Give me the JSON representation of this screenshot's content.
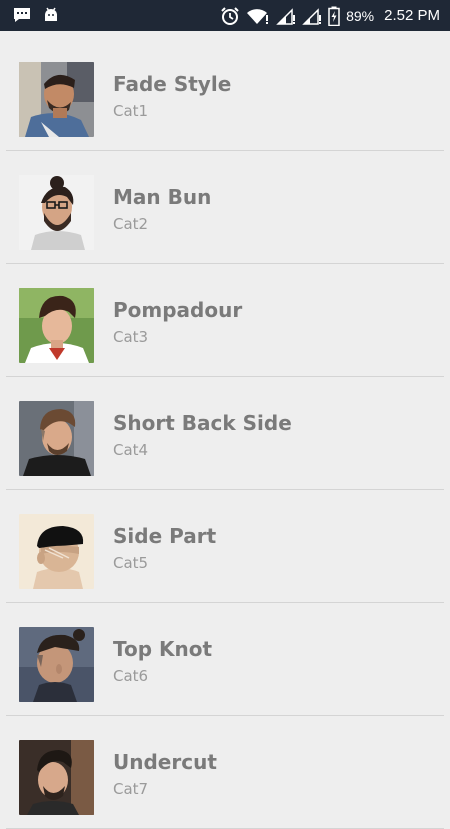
{
  "status_bar": {
    "battery_percent": "89%",
    "time": "2.52 PM",
    "left_icons": [
      "chat-notification-icon",
      "android-debug-icon"
    ],
    "right_icons": [
      "alarm-icon",
      "wifi-icon",
      "signal-icon",
      "signal-icon",
      "battery-charging-icon"
    ]
  },
  "list": {
    "items": [
      {
        "title": "Fade Style",
        "subtitle": "Cat1",
        "thumbnail": "fade-style-photo"
      },
      {
        "title": "Man Bun",
        "subtitle": "Cat2",
        "thumbnail": "man-bun-photo"
      },
      {
        "title": "Pompadour",
        "subtitle": "Cat3",
        "thumbnail": "pompadour-photo"
      },
      {
        "title": "Short Back Side",
        "subtitle": "Cat4",
        "thumbnail": "short-back-side-photo"
      },
      {
        "title": "Side Part",
        "subtitle": "Cat5",
        "thumbnail": "side-part-photo"
      },
      {
        "title": "Top Knot",
        "subtitle": "Cat6",
        "thumbnail": "top-knot-photo"
      },
      {
        "title": "Undercut",
        "subtitle": "Cat7",
        "thumbnail": "undercut-photo"
      }
    ]
  }
}
